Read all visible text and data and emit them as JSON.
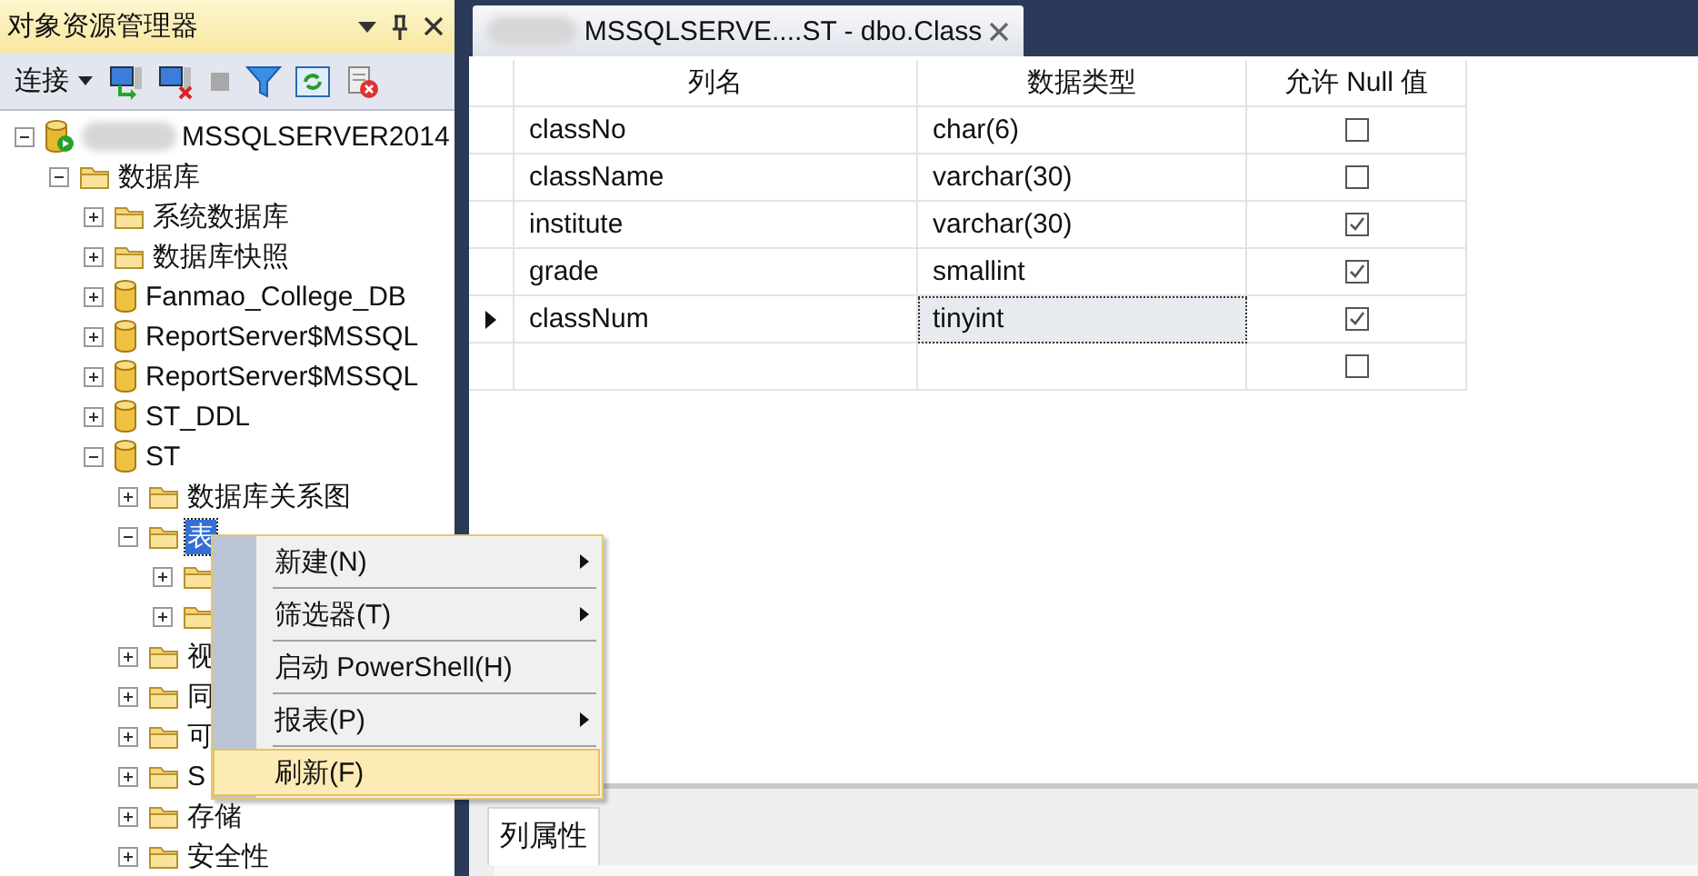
{
  "explorer": {
    "title": "对象资源管理器",
    "connect_label": "连接",
    "tree": [
      {
        "label": "MSSQLSERVER2014",
        "kind": "server",
        "expanded": true,
        "selected": false,
        "children": [
          {
            "label": "数据库",
            "kind": "folder",
            "expanded": true,
            "selected": false,
            "children": [
              {
                "label": "系统数据库",
                "kind": "folder",
                "expanded": false,
                "selected": false
              },
              {
                "label": "数据库快照",
                "kind": "folder",
                "expanded": false,
                "selected": false
              },
              {
                "label": "Fanmao_College_DB",
                "kind": "database",
                "expanded": false,
                "selected": false
              },
              {
                "label": "ReportServer$MSSQL",
                "kind": "database",
                "expanded": false,
                "selected": false
              },
              {
                "label": "ReportServer$MSSQL",
                "kind": "database",
                "expanded": false,
                "selected": false
              },
              {
                "label": "ST_DDL",
                "kind": "database",
                "expanded": false,
                "selected": false
              },
              {
                "label": "ST",
                "kind": "database",
                "expanded": true,
                "selected": false,
                "children": [
                  {
                    "label": "数据库关系图",
                    "kind": "folder",
                    "expanded": false,
                    "selected": false
                  },
                  {
                    "label": "表",
                    "kind": "folder",
                    "expanded": true,
                    "selected": true,
                    "children": [
                      {
                        "kind": "folder",
                        "expanded": false
                      },
                      {
                        "kind": "folder",
                        "expanded": false
                      }
                    ]
                  },
                  {
                    "label": "视",
                    "kind": "folder",
                    "expanded": false,
                    "selected": false
                  },
                  {
                    "label": "同",
                    "kind": "folder",
                    "expanded": false,
                    "selected": false
                  },
                  {
                    "label": "可",
                    "kind": "folder",
                    "expanded": false,
                    "selected": false
                  },
                  {
                    "label": "S",
                    "kind": "folder",
                    "expanded": false,
                    "selected": false
                  },
                  {
                    "label": "存储",
                    "kind": "folder",
                    "expanded": false,
                    "selected": false
                  },
                  {
                    "label": "安全性",
                    "kind": "folder",
                    "expanded": false,
                    "selected": false
                  }
                ]
              }
            ]
          }
        ]
      }
    ]
  },
  "context_menu": {
    "items": [
      {
        "label": "新建(N)",
        "submenu": true,
        "selected": false
      },
      {
        "label": "筛选器(T)",
        "submenu": true,
        "selected": false
      },
      {
        "label": "启动 PowerShell(H)",
        "submenu": false,
        "selected": false
      },
      {
        "label": "报表(P)",
        "submenu": true,
        "selected": false
      },
      {
        "label": "刷新(F)",
        "submenu": false,
        "selected": true
      }
    ]
  },
  "document_tab": {
    "title": "MSSQLSERVE....ST - dbo.Class"
  },
  "table_designer": {
    "columns": [
      "列名",
      "数据类型",
      "允许 Null 值"
    ],
    "rows": [
      {
        "name": "classNo",
        "type": "char(6)",
        "allow_null": false,
        "current": false
      },
      {
        "name": "className",
        "type": "varchar(30)",
        "allow_null": false,
        "current": false
      },
      {
        "name": "institute",
        "type": "varchar(30)",
        "allow_null": true,
        "current": false
      },
      {
        "name": "grade",
        "type": "smallint",
        "allow_null": true,
        "current": false
      },
      {
        "name": "classNum",
        "type": "tinyint",
        "allow_null": true,
        "current": true
      },
      {
        "allow_null": false,
        "current": false
      }
    ]
  },
  "properties_tab": {
    "label": "列属性"
  }
}
